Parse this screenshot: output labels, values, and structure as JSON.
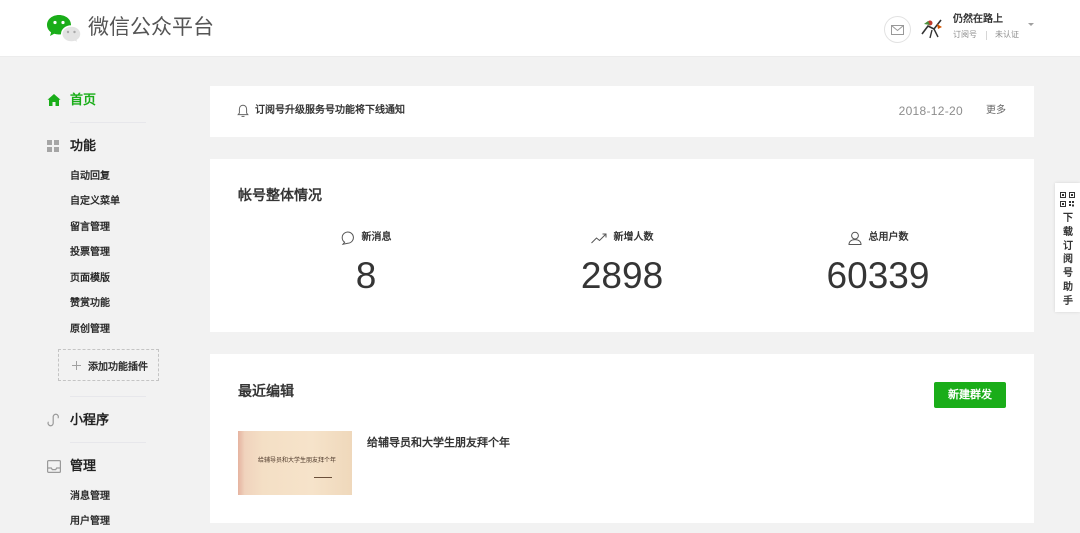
{
  "header": {
    "title": "微信公众平台",
    "logo_icon": "wechat-logo-icon",
    "mail_icon": "mail-icon",
    "account": {
      "name": "仍然在路上",
      "type": "订阅号",
      "status": "未认证"
    }
  },
  "sidebar": {
    "home": {
      "label": "首页",
      "icon": "home-icon",
      "active": true
    },
    "features": {
      "label": "功能",
      "icon": "grid-icon",
      "items": [
        "自动回复",
        "自定义菜单",
        "留言管理",
        "投票管理",
        "页面模版",
        "赞赏功能",
        "原创管理"
      ],
      "add_plugin": {
        "icon": "plus-icon",
        "label": "添加功能插件"
      }
    },
    "miniprogram": {
      "label": "小程序",
      "icon": "link-icon"
    },
    "management": {
      "label": "管理",
      "icon": "inbox-icon",
      "items": [
        "消息管理",
        "用户管理"
      ]
    }
  },
  "main": {
    "notice": {
      "icon": "bell-icon",
      "text": "订阅号升级服务号功能将下线通知",
      "date": "2018-12-20",
      "more_label": "更多"
    },
    "overview": {
      "title": "帐号整体情况",
      "stats": [
        {
          "icon": "chat-bubble-icon",
          "label": "新消息",
          "value": 8
        },
        {
          "icon": "trend-up-icon",
          "label": "新增人数",
          "value": 2898
        },
        {
          "icon": "user-icon",
          "label": "总用户数",
          "value": 60339
        }
      ]
    },
    "recent": {
      "title": "最近编辑",
      "new_button_label": "新建群发",
      "articles": [
        {
          "title": "给辅导员和大学生朋友拜个年",
          "thumbnail_caption": "给辅导员和大学生朋友拜个年"
        }
      ]
    }
  },
  "side_tab": {
    "icon": "qr-code-icon",
    "label": "下载订阅号助手"
  },
  "colors": {
    "accent": "#1aad19",
    "background": "#f2f2f2",
    "panel": "#ffffff",
    "text": "#353535",
    "muted": "#8d8d8d"
  }
}
